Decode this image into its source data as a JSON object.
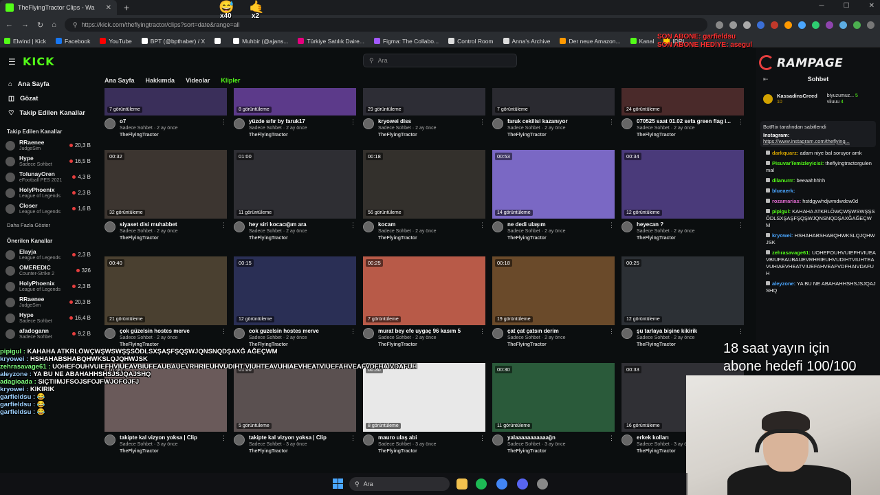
{
  "browser": {
    "tab_title": "TheFlyingTractor Clips - Wa",
    "url": "https://kick.com/theflyingtractor/clips?sort=date&range=all",
    "bookmarks": [
      {
        "label": "Elwind | Kick",
        "color": "#53fc18"
      },
      {
        "label": "Facebook",
        "color": "#1877f2"
      },
      {
        "label": "YouTube",
        "color": "#ff0000"
      },
      {
        "label": "BPT (@bpthaber) / X",
        "color": "#ffffff"
      },
      {
        "label": "",
        "color": "#ffffff"
      },
      {
        "label": "Muhbir (@ajans...",
        "color": "#ffffff"
      },
      {
        "label": "Türkiye Satılık Daire...",
        "color": "#e6007e"
      },
      {
        "label": "Figma: The Collabo...",
        "color": "#a259ff"
      },
      {
        "label": "Control Room",
        "color": "#dddddd"
      },
      {
        "label": "Anna's Archive",
        "color": "#dddddd"
      },
      {
        "label": "Der neue Amazon...",
        "color": "#ff9900"
      },
      {
        "label": "Kanal",
        "color": "#53fc18"
      },
      {
        "label": "IDRI",
        "color": "#ffcc00"
      }
    ]
  },
  "header": {
    "logo": "KICK",
    "search_placeholder": "Ara"
  },
  "sidebar": {
    "links": [
      {
        "label": "Ana Sayfa",
        "icon": "home-icon",
        "glyph": "⌂"
      },
      {
        "label": "Gözat",
        "icon": "browse-icon",
        "glyph": "◫"
      },
      {
        "label": "Takip Edilen Kanallar",
        "icon": "heart-icon",
        "glyph": "♡"
      }
    ],
    "followed_title": "Takip Edilen Kanallar",
    "followed": [
      {
        "name": "RRaenee",
        "category": "JudgeSim",
        "viewers": "20,3 B"
      },
      {
        "name": "Hype",
        "category": "Sadece Sohbet",
        "viewers": "16,5 B"
      },
      {
        "name": "TolunayOren",
        "category": "eFootball PES 2021",
        "viewers": "4,3 B"
      },
      {
        "name": "HolyPhoenix",
        "category": "League of Legends",
        "viewers": "2,3 B"
      },
      {
        "name": "Closer",
        "category": "League of Legends",
        "viewers": "1,6 B"
      }
    ],
    "show_more": "Daha Fazla Göster",
    "recommended_title": "Önerilen Kanallar",
    "recommended": [
      {
        "name": "Elayja",
        "category": "League of Legends",
        "viewers": "2,3 B"
      },
      {
        "name": "OMEREDIC",
        "category": "Counter-Strike 2",
        "viewers": "326"
      },
      {
        "name": "HolyPhoenix",
        "category": "League of Legends",
        "viewers": "2,3 B"
      },
      {
        "name": "RRaenee",
        "category": "JudgeSim",
        "viewers": "20,3 B"
      },
      {
        "name": "Hype",
        "category": "Sadece Sohbet",
        "viewers": "16,4 B"
      },
      {
        "name": "afadogann",
        "category": "Sadece Sohbet",
        "viewers": "9,2 B"
      }
    ]
  },
  "channel_tabs": [
    {
      "label": "Ana Sayfa",
      "active": false
    },
    {
      "label": "Hakkımda",
      "active": false
    },
    {
      "label": "Videolar",
      "active": false
    },
    {
      "label": "Klipler",
      "active": true
    }
  ],
  "clips": [
    {
      "title": "o7",
      "duration": "",
      "views": "7 görüntüleme",
      "category": "Sadece Sohbet",
      "age": "2 ay önce",
      "channel": "TheFlyingTractor",
      "color": "#3a2f5a"
    },
    {
      "title": "yüzde sıfır by faruk17",
      "duration": "",
      "views": "8 görüntüleme",
      "category": "Sadece Sohbet",
      "age": "2 ay önce",
      "channel": "TheFlyingTractor",
      "color": "#5c3a8a"
    },
    {
      "title": "kryowei diss",
      "duration": "",
      "views": "29 görüntüleme",
      "category": "Sadece Sohbet",
      "age": "2 ay önce",
      "channel": "TheFlyingTractor",
      "color": "#2d2d35"
    },
    {
      "title": "faruk cekilisi kazanıyor",
      "duration": "",
      "views": "7 görüntüleme",
      "category": "Sadece Sohbet",
      "age": "2 ay önce",
      "channel": "TheFlyingTractor",
      "color": "#2a2a30"
    },
    {
      "title": "070525 saat 01.02 sefa green flag i...",
      "duration": "",
      "views": "24 görüntüleme",
      "category": "Sadece Sohbet",
      "age": "2 ay önce",
      "channel": "TheFlyingTractor",
      "color": "#4a2a2a"
    },
    {
      "title": "siyaset disi muhabbet",
      "duration": "00:32",
      "views": "32 görüntüleme",
      "category": "Sadece Sohbet",
      "age": "2 ay önce",
      "channel": "TheFlyingTractor",
      "color": "#3c3530"
    },
    {
      "title": "hey siri kocacığım ara",
      "duration": "01:00",
      "views": "11 görüntüleme",
      "category": "Sadece Sohbet",
      "age": "2 ay önce",
      "channel": "TheFlyingTractor",
      "color": "#2e2e33"
    },
    {
      "title": "kocam",
      "duration": "00:18",
      "views": "56 görüntüleme",
      "category": "Sadece Sohbet",
      "age": "2 ay önce",
      "channel": "TheFlyingTractor",
      "color": "#33302c"
    },
    {
      "title": "ne dedi ulaşım",
      "duration": "00:53",
      "views": "14 görüntüleme",
      "category": "Sadece Sohbet",
      "age": "2 ay önce",
      "channel": "TheFlyingTractor",
      "color": "#7a68c4"
    },
    {
      "title": "heyecan ?",
      "duration": "00:34",
      "views": "12 görüntüleme",
      "category": "Sadece Sohbet",
      "age": "2 ay önce",
      "channel": "TheFlyingTractor",
      "color": "#4a3a7a"
    },
    {
      "title": "çok güzelsin hostes merve",
      "duration": "00:40",
      "views": "21 görüntüleme",
      "category": "Sadece Sohbet",
      "age": "2 ay önce",
      "channel": "TheFlyingTractor",
      "color": "#4a4030"
    },
    {
      "title": "cok guzelsin hostes merve",
      "duration": "00:15",
      "views": "12 görüntüleme",
      "category": "Sadece Sohbet",
      "age": "2 ay önce",
      "channel": "TheFlyingTractor",
      "color": "#2a2f55"
    },
    {
      "title": "murat bey efe uygaç 96 kasım 5",
      "duration": "00:25",
      "views": "7 görüntüleme",
      "category": "Sadece Sohbet",
      "age": "2 ay önce",
      "channel": "TheFlyingTractor",
      "color": "#b85a48"
    },
    {
      "title": "çat çat çatsın derim",
      "duration": "00:18",
      "views": "19 görüntüleme",
      "category": "Sadece Sohbet",
      "age": "2 ay önce",
      "channel": "TheFlyingTractor",
      "color": "#6a4a2a"
    },
    {
      "title": "şu tarlaya bişine kikirik",
      "duration": "00:25",
      "views": "12 görüntüleme",
      "category": "Sadece Sohbet",
      "age": "2 ay önce",
      "channel": "TheFlyingTractor",
      "color": "#2c3035"
    },
    {
      "title": "takipte kal vizyon yoksa | Clip",
      "duration": "01:00",
      "views": "",
      "category": "Sadece Sohbet",
      "age": "3 ay önce",
      "channel": "TheFlyingTractor",
      "color": "#6a5a5a"
    },
    {
      "title": "takipte kal vizyon yoksa | Clip",
      "duration": "01:00",
      "views": "5 görüntüleme",
      "category": "Sadece Sohbet",
      "age": "3 ay önce",
      "channel": "TheFlyingTractor",
      "color": "#5a5050"
    },
    {
      "title": "mauro ulaş abi",
      "duration": "00:30",
      "views": "8 görüntüleme",
      "category": "Sadece Sohbet",
      "age": "3 ay önce",
      "channel": "TheFlyingTractor",
      "color": "#e8e8e8"
    },
    {
      "title": "yalaaaaaaaaaaağn",
      "duration": "00:30",
      "views": "11 görüntüleme",
      "category": "Sadece Sohbet",
      "age": "3 ay önce",
      "channel": "TheFlyingTractor",
      "color": "#2a5a3a"
    },
    {
      "title": "erkek kolları",
      "duration": "00:33",
      "views": "16 görüntüleme",
      "category": "Sadece Sohbet",
      "age": "3 ay önce",
      "channel": "TheFlyingTractor",
      "color": "#303035"
    }
  ],
  "chat": {
    "brand": "RAMPAGE",
    "title": "Sohbet",
    "top_gifter": "KassadinsCreed",
    "top_gifter_count": "10",
    "top_gifter_2": "biyuzumuz...",
    "top_gifter_2_count": "5",
    "top_gifter_3": "viiuuu",
    "top_gifter_3_count": "4",
    "pinned_by": "BotRix tarafından sabitlendi",
    "pinned_label": "Instagram:",
    "pinned_link": "https://www.instagram.com/theflying...",
    "messages": [
      {
        "user": "darkquarz:",
        "text": "adam niye bal soruyor amk",
        "color": "#d2a200"
      },
      {
        "user": "PisuvarTemizleyicisi:",
        "text": "theflyingtractorgulenmal",
        "color": "#53fc18"
      },
      {
        "user": "dilanurrr:",
        "text": "beeaahhhhh",
        "color": "#53fc18"
      },
      {
        "user": "blueaerk:",
        "text": "",
        "color": "#4aa6ff"
      },
      {
        "user": "rozamarias:",
        "text": "hstdgywhdjwmdwdow0d",
        "color": "#e06bd0"
      },
      {
        "user": "pipigul:",
        "text": "KAHAHA ATKRLÖWÇWŞWSWŞŞSÖDLSXŞAŞFŞQŞWJQNSNQDŞAXĞAĞEÇWM",
        "color": "#53fc18"
      },
      {
        "user": "kryowei:",
        "text": "HSHAHABSHABQHWKSLQJQHWJSK",
        "color": "#4aa6ff"
      },
      {
        "user": "zehrasavage61:",
        "text": "UOHEFOUHVUIEFHVIUEAVBIUFEAUBAUEVRHRIEUHVUDIHTVIUHTEAVUHIAEVHEATVIUEFAHVEAFVDFHAIVDAFUH",
        "color": "#53fc18"
      },
      {
        "user": "aleyzone:",
        "text": "YA BU NE ABAHAHHSHSJSJQAJSHQ",
        "color": "#4aa6ff"
      }
    ]
  },
  "overlay": {
    "sub_note_1": "SON ABONE: garfieldsu",
    "sub_note_2": "SON ABONE HEDİYE: asegul",
    "goal_line_1": "18 saat yayın için",
    "goal_line_2": "abone hedefi 100/100",
    "chat": [
      {
        "user": "pipigul :",
        "text": "KAHAHA ATKRLÖWÇWŞWSWŞŞSÖDLSXŞAŞFŞQŞWJQNSNQDŞAXĞ AĞEÇWM",
        "color": "#7fff7f"
      },
      {
        "user": "kryowei :",
        "text": "HSHAHABSHABQHWKSLQJQHWJSK",
        "color": "#9fd2ff"
      },
      {
        "user": "zehrasavage61 :",
        "text": "UOHEFOUHVUIEFHVIUEAVBIUFEAUBAUEVRHRIEUHVUDIHT VIUHTEAVUHIAEVHEATVIUEFAHVEAFVDFHAIVDAFUH",
        "color": "#7fff7f"
      },
      {
        "user": "aleyzone :",
        "text": "YA BU NE ABAHAHHSHSJSJQAJSHQ",
        "color": "#9fd2ff"
      },
      {
        "user": "adagioada :",
        "text": "SIÇTIIMJFSOJSFOJFWJOFOJFJ",
        "color": "#7fff7f"
      },
      {
        "user": "kryowei :",
        "text": "KIKIRIK",
        "color": "#9fd2ff"
      },
      {
        "user": "garfieldsu :",
        "text": "😂",
        "color": "#9fd2ff"
      },
      {
        "user": "garfieldsu :",
        "text": "😂",
        "color": "#9fd2ff"
      },
      {
        "user": "garfieldsu :",
        "text": "😂",
        "color": "#9fd2ff"
      }
    ]
  },
  "taskbar": {
    "search_placeholder": "Ara"
  },
  "emotes": {
    "count_1": "x40",
    "count_2": "x2"
  }
}
